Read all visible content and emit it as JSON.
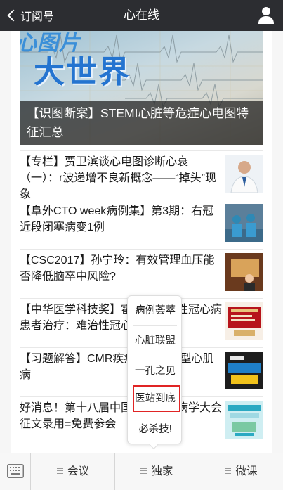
{
  "header": {
    "back_label": "订阅号",
    "title": "心在线"
  },
  "hero": {
    "logo_line1": "心图片",
    "logo_line2": "大世界",
    "caption": "【识图断案】STEMI心脏等危症心电图特征汇总"
  },
  "articles": [
    {
      "title": "【专栏】贾卫滨谈心电图诊断心衰（一）：r波递增不良新概念——“掉头”现象"
    },
    {
      "title": "【阜外CTO week病例集】第3期：右冠近段闭塞病变1例"
    },
    {
      "title": "【CSC2017】孙宁玲：有效管理血压能否降低脑卒中风险?"
    },
    {
      "title": "【中华医学科技奖】霍勇：难治性冠心病患者治疗：难治性冠心病患者"
    },
    {
      "title": "【习题解答】CMR疾病解答：典型心肌病"
    },
    {
      "title": "好消息！第十八届中国介入心脏病学大会 征文录用=免费参会"
    }
  ],
  "popup_menu": {
    "items": [
      "病例荟萃",
      "心脏联盟",
      "一孔之见",
      "医站到底",
      "必杀技!"
    ],
    "highlighted_index": 3,
    "highlight_color": "#e02424"
  },
  "bottom_bar": {
    "tabs": [
      "会议",
      "独家",
      "微课"
    ]
  },
  "colors": {
    "header_bg": "#2c2d31",
    "hero_caption_bg": "#1e1e1e"
  }
}
